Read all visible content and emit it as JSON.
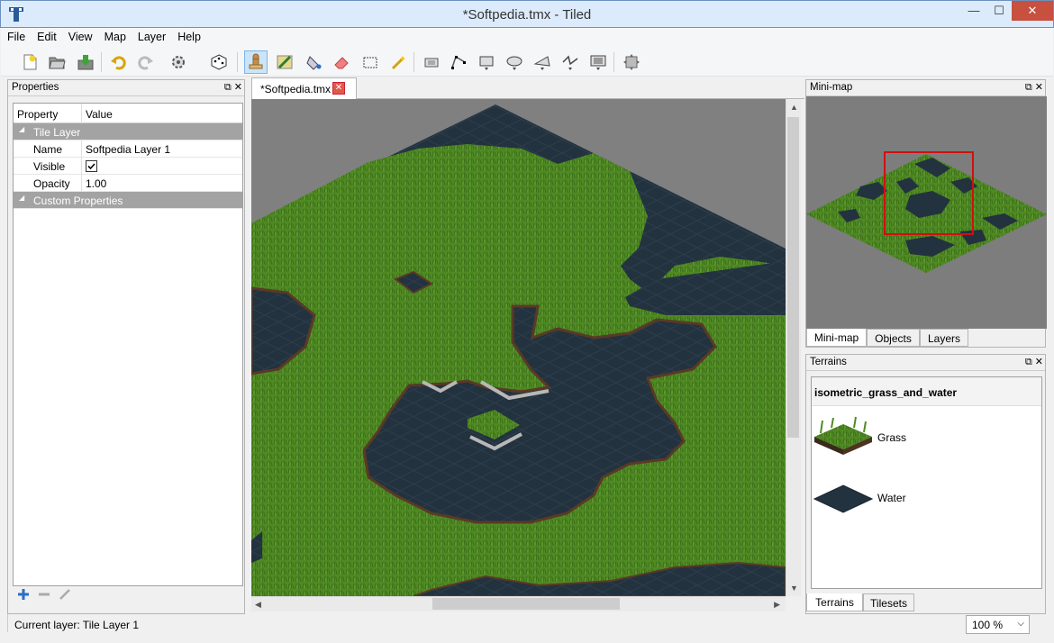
{
  "window": {
    "title": "*Softpedia.tmx - Tiled",
    "minimize": "—",
    "maximize": "☐",
    "close": "✕"
  },
  "menu": [
    "File",
    "Edit",
    "View",
    "Map",
    "Layer",
    "Help"
  ],
  "toolbar": {
    "icons": [
      "new-file-icon",
      "open-file-icon",
      "save-file-icon",
      "undo-icon",
      "redo-icon",
      "commands-icon",
      "random-mode-icon",
      "stamp-brush-icon",
      "terrain-brush-icon",
      "bucket-fill-icon",
      "eraser-icon",
      "rectangular-select-icon",
      "magic-wand-icon",
      "select-objects-icon",
      "edit-polygons-icon",
      "insert-rectangle-icon",
      "insert-ellipse-icon",
      "insert-polygon-icon",
      "insert-polyline-icon",
      "insert-tile-icon",
      "move-icon"
    ],
    "active_tool": "stamp-brush-icon"
  },
  "properties": {
    "title": "Properties",
    "columns": [
      "Property",
      "Value"
    ],
    "group_tile_layer": "Tile Layer",
    "rows": [
      {
        "key": "Name",
        "value": "Softpedia Layer 1"
      },
      {
        "key": "Visible",
        "value": ""
      },
      {
        "key": "Opacity",
        "value": "1.00"
      }
    ],
    "visible_checked": true,
    "group_custom": "Custom Properties"
  },
  "editor": {
    "tab_label": "*Softpedia.tmx",
    "tab_close": "✕"
  },
  "minimap": {
    "title": "Mini-map",
    "tabs": [
      "Mini-map",
      "Objects",
      "Layers"
    ],
    "selected_tab": "Mini-map"
  },
  "terrains": {
    "title": "Terrains",
    "tileset_name": "isometric_grass_and_water",
    "items": [
      {
        "name": "Grass",
        "color": "#4f8a23"
      },
      {
        "name": "Water",
        "color": "#24323e"
      }
    ],
    "tabs": [
      "Terrains",
      "Tilesets"
    ],
    "selected_tab": "Terrains"
  },
  "status": {
    "current_layer": "Current layer: Tile Layer 1",
    "zoom": "100 %"
  },
  "colors": {
    "grass": "#4f8a23",
    "grass_dark": "#3d6f1a",
    "water": "#23323f",
    "background": "#808080",
    "minimap_frame": "#d01010"
  }
}
